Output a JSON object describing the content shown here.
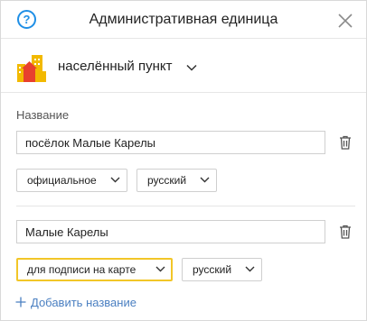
{
  "header": {
    "title": "Административная единица"
  },
  "category": {
    "label": "населённый пункт"
  },
  "names_section": {
    "label": "Название",
    "entries": [
      {
        "value": "посёлок Малые Карелы",
        "type_label": "официальное",
        "language_label": "русский"
      },
      {
        "value": "Малые Карелы",
        "type_label": "для подписи на карте",
        "language_label": "русский"
      }
    ],
    "add_label": "Добавить название"
  },
  "colors": {
    "accent_blue": "#1f8fe6",
    "link_blue": "#4a7fc1",
    "focus_yellow": "#f2c628"
  }
}
